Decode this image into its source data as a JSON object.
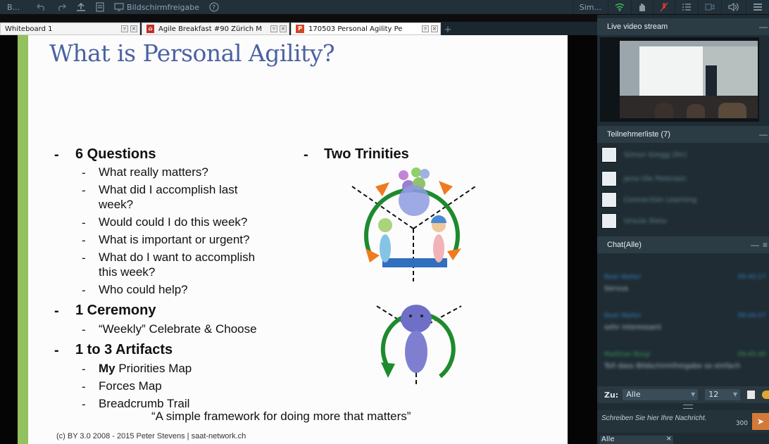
{
  "toolbar": {
    "app_label": "B...",
    "screen_share_label": "Bildschirmfreigabe",
    "sim_label": "Sim..."
  },
  "tabs": [
    {
      "label": "Whiteboard 1",
      "icon": "whiteboard-icon"
    },
    {
      "label": "Agile Breakfast #90 Zürich M",
      "icon": "pdf-icon"
    },
    {
      "label": "170503 Personal Agility Pe",
      "icon": "powerpoint-icon"
    }
  ],
  "slide": {
    "title": "What is Personal Agility?",
    "left_column": {
      "q_heading": "6 Questions",
      "questions": [
        "What really matters?",
        "What did I accomplish last",
        "week?",
        "Would could I do this week?",
        "What is important or urgent?",
        "What do I want to accomplish",
        "this week?",
        "Who could help?"
      ],
      "ceremony_heading": "1 Ceremony",
      "ceremony_item": "“Weekly” Celebrate & Choose",
      "artifacts_heading": "1 to 3 Artifacts",
      "artifact_my": "My",
      "artifact_priorities": " Priorities Map",
      "artifact_forces": "Forces Map",
      "artifact_breadcrumb": "Breadcrumb Trail"
    },
    "right_column": {
      "heading": "Two Trinities"
    },
    "tagline": "“A simple framework for doing more that matters”",
    "footer": "(c) BY 3.0 2008 - 2015 Peter Stevens | saat-network.ch"
  },
  "sidebar": {
    "video_title": "Live video stream",
    "participants_title": "Teilnehmerliste (7)",
    "participants": [
      "Simon Gregg (Ihr)",
      "Jens-Ole Petersen",
      "Connection Learning",
      "Ursula Steiu"
    ],
    "chat_title": "Chat(Alle)",
    "chat": [
      {
        "name": "Beat Walter",
        "time": "09:40:27",
        "text": "Servus"
      },
      {
        "name": "Beat Walter",
        "time": "09:44:07",
        "text": "sehr interessant"
      },
      {
        "name": "Matthias Bürgi",
        "time": "09:45:40",
        "text": "Toll dass Bildschirmfreigabe so einfach"
      }
    ],
    "zu_label": "Zu:",
    "zu_select": "Alle",
    "font_size": "12",
    "input_placeholder": "Schreiben Sie hier Ihre Nachricht.",
    "char_count": "300",
    "bottom_tab": "Alle"
  },
  "colors": {
    "slide_title": "#4b62a3",
    "accent_bar": "#92c15d",
    "topbar": "#223039",
    "sidebar": "#1f2c33",
    "send_button": "#d47a39"
  }
}
